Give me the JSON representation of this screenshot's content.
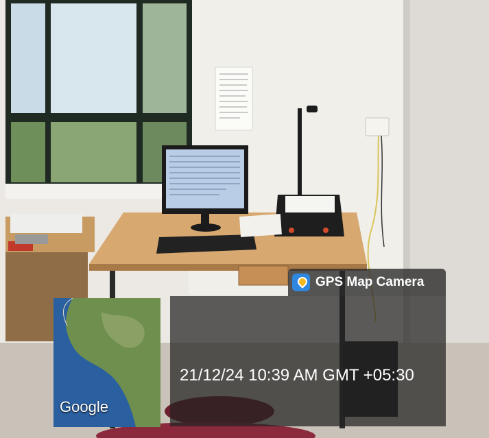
{
  "watermark": {
    "app_name": "GPS Map Camera",
    "app_icon": "map-pin-camera-icon",
    "datetime": "21/12/24 10:39 AM GMT +05:30"
  },
  "map_thumbnail": {
    "provider_label": "Google"
  },
  "colors": {
    "frame_border": "#3b2353",
    "overlay_bg": "#232323",
    "ocean": "#2a5fa0",
    "land": "#6f8f4e"
  }
}
